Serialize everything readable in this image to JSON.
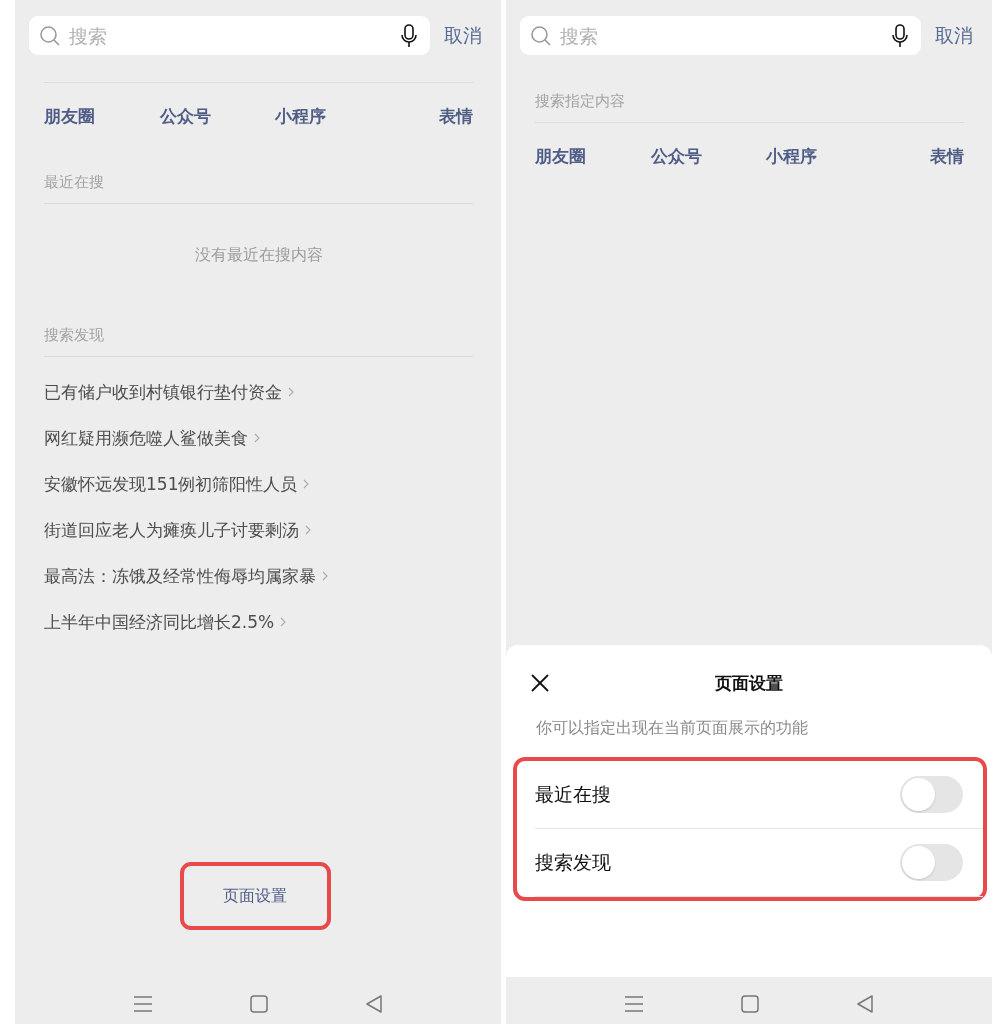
{
  "screens": [
    {
      "search": {
        "placeholder": "搜索"
      },
      "cancel_button": "取消",
      "content_types": [
        "朋友圈",
        "公众号",
        "小程序",
        "表情"
      ],
      "recent": {
        "title": "最近在搜",
        "empty_text": "没有最近在搜内容"
      },
      "discover": {
        "title": "搜索发现",
        "items": [
          "已有储户收到村镇银行垫付资金",
          "网红疑用濒危噬人鲨做美食",
          "安徽怀远发现151例初筛阳性人员",
          "街道回应老人为瘫痪儿子讨要剩汤",
          "最高法：冻饿及经常性侮辱均属家暴",
          "上半年中国经济同比增长2.5%"
        ]
      },
      "settings_button": {
        "label": "页面设置",
        "highlighted": true
      }
    },
    {
      "search": {
        "placeholder": "搜索"
      },
      "cancel_button": "取消",
      "content_title": "搜索指定内容",
      "content_types": [
        "朋友圈",
        "公众号",
        "小程序",
        "表情"
      ],
      "sheet": {
        "title": "页面设置",
        "description": "你可以指定出现在当前页面展示的功能",
        "highlighted": true,
        "options": [
          {
            "label": "最近在搜",
            "on": false
          },
          {
            "label": "搜索发现",
            "on": false
          }
        ]
      }
    }
  ]
}
